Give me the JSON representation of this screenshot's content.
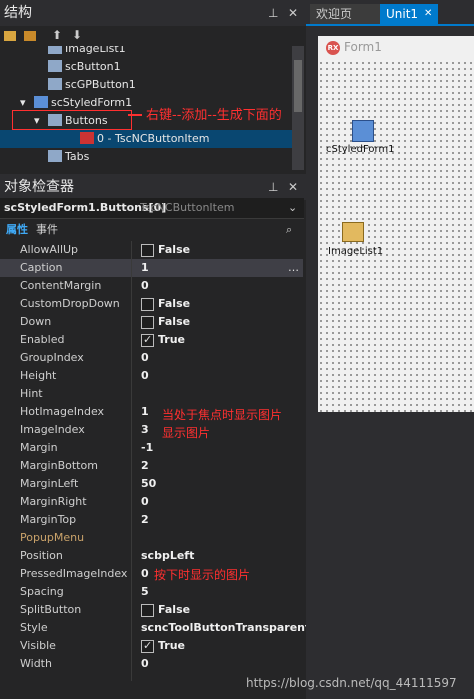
{
  "structure": {
    "title": "结构",
    "tree": [
      {
        "label": "ImageList1",
        "indent": 48
      },
      {
        "label": "scButton1",
        "indent": 48
      },
      {
        "label": "scGPButton1",
        "indent": 48
      },
      {
        "label": "scStyledForm1",
        "indent": 34
      },
      {
        "label": "Buttons",
        "indent": 48
      },
      {
        "label": "0 - TscNCButtonItem",
        "indent": 80
      },
      {
        "label": "Tabs",
        "indent": 48
      }
    ],
    "annotation": "右键--添加--生成下面的"
  },
  "tabs": [
    {
      "label": "欢迎页"
    },
    {
      "label": "Unit1"
    }
  ],
  "designer": {
    "form_caption": "Form1",
    "components": [
      {
        "label": "cStyledForm1"
      },
      {
        "label": "ImageList1"
      }
    ]
  },
  "inspector": {
    "title": "对象检查器",
    "object": "scStyledForm1.Buttons[0]",
    "object_type": "TscNCButtonItem",
    "tab_props": "属性",
    "tab_events": "事件",
    "rows": [
      {
        "name": "AllowAllUp",
        "value": "False",
        "check": "off"
      },
      {
        "name": "Caption",
        "value": "1",
        "check": "none"
      },
      {
        "name": "ContentMargin",
        "value": "0",
        "check": "none"
      },
      {
        "name": "CustomDropDown",
        "value": "False",
        "check": "off"
      },
      {
        "name": "Down",
        "value": "False",
        "check": "off"
      },
      {
        "name": "Enabled",
        "value": "True",
        "check": "on"
      },
      {
        "name": "GroupIndex",
        "value": "0",
        "check": "none"
      },
      {
        "name": "Height",
        "value": "0",
        "check": "none"
      },
      {
        "name": "Hint",
        "value": "",
        "check": "none"
      },
      {
        "name": "HotImageIndex",
        "value": "1",
        "check": "none"
      },
      {
        "name": "ImageIndex",
        "value": "3",
        "check": "none"
      },
      {
        "name": "Margin",
        "value": "-1",
        "check": "none"
      },
      {
        "name": "MarginBottom",
        "value": "2",
        "check": "none"
      },
      {
        "name": "MarginLeft",
        "value": "50",
        "check": "none"
      },
      {
        "name": "MarginRight",
        "value": "0",
        "check": "none"
      },
      {
        "name": "MarginTop",
        "value": "2",
        "check": "none"
      },
      {
        "name": "PopupMenu",
        "value": "",
        "check": "none"
      },
      {
        "name": "Position",
        "value": "scbpLeft",
        "check": "none"
      },
      {
        "name": "PressedImageIndex",
        "value": "0",
        "check": "none"
      },
      {
        "name": "Spacing",
        "value": "5",
        "check": "none"
      },
      {
        "name": "SplitButton",
        "value": "False",
        "check": "off"
      },
      {
        "name": "Style",
        "value": "scncToolButtonTransparent",
        "check": "none"
      },
      {
        "name": "Visible",
        "value": "True",
        "check": "on"
      },
      {
        "name": "Width",
        "value": "0",
        "check": "none"
      }
    ],
    "annotation_hot": "当处于焦点时显示图片",
    "annotation_hot2": "显示图片",
    "annotation_pressed": "按下时显示的图片"
  },
  "watermark": "https://blog.csdn.net/qq_44111597",
  "colors": {
    "accent": "#007acc",
    "selection": "#094771",
    "annotation": "#ff3030"
  }
}
